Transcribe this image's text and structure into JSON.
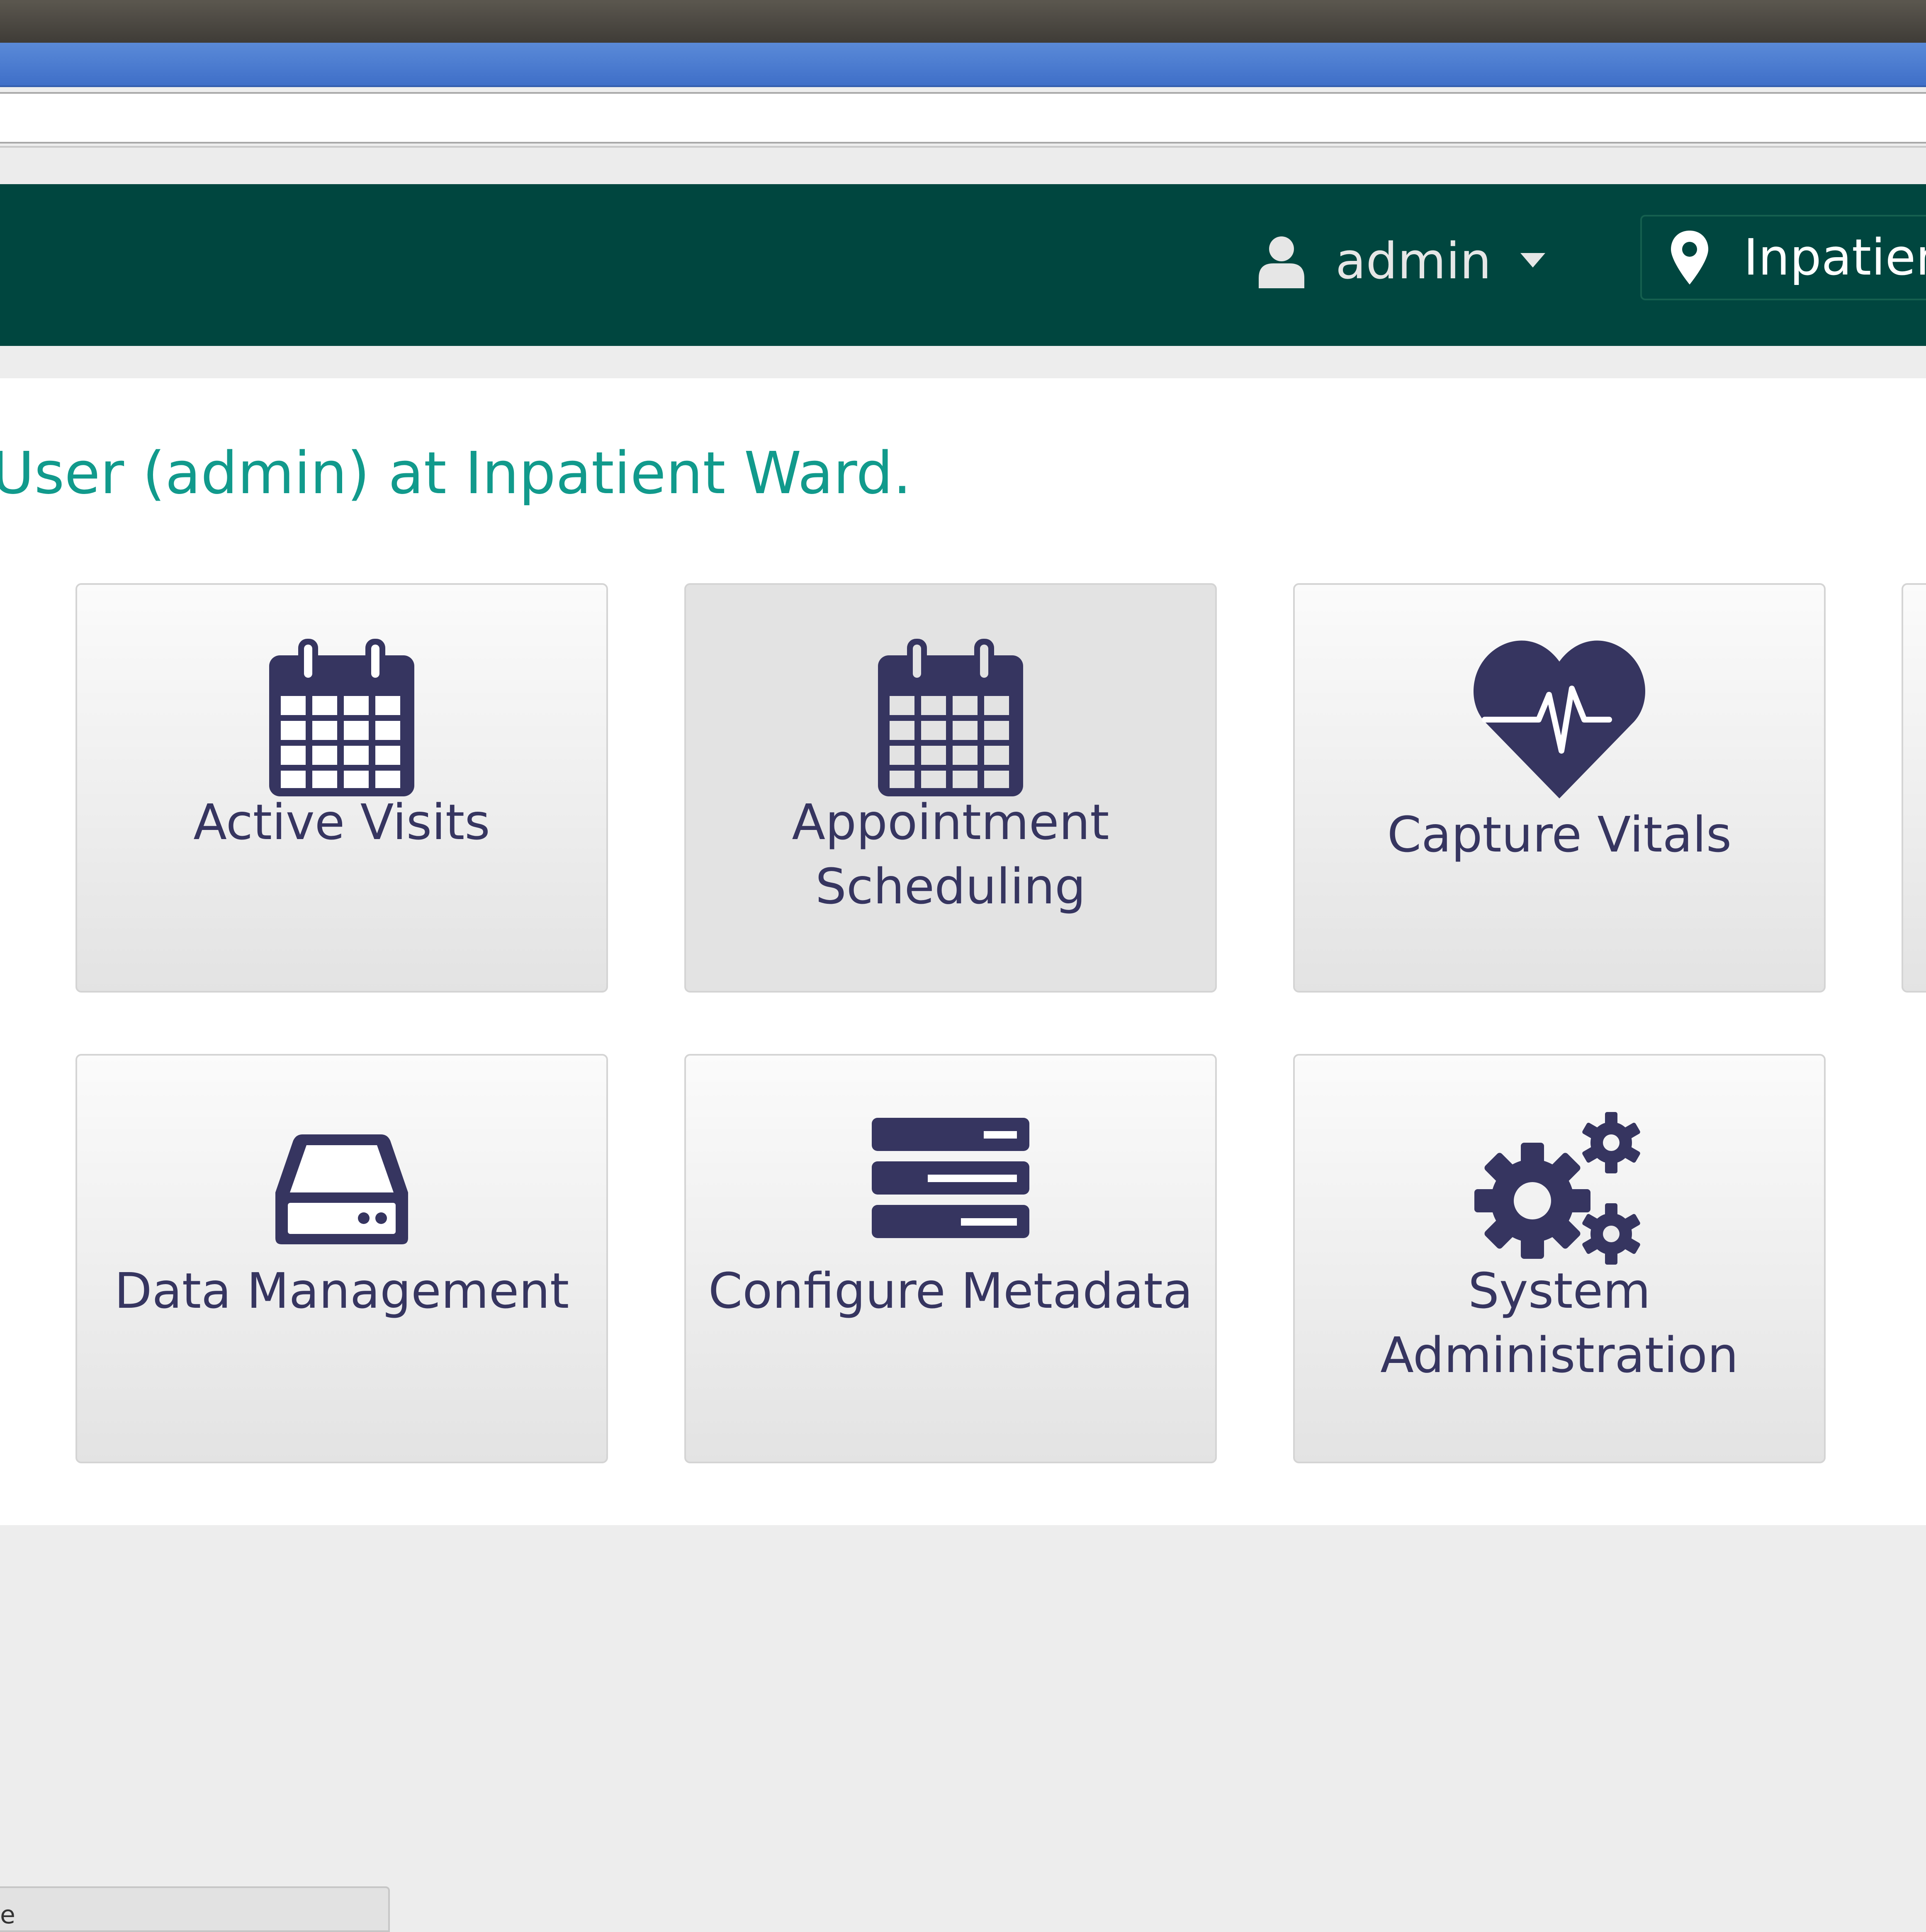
{
  "header": {
    "user_name": "admin",
    "location_name": "Inpatient Ward"
  },
  "welcome": {
    "text": "User (admin) at Inpatient Ward."
  },
  "apps": [
    {
      "label": "Active Visits",
      "icon": "calendar-icon"
    },
    {
      "label": "Appointment Scheduling",
      "icon": "calendar-icon"
    },
    {
      "label": "Capture Vitals",
      "icon": "heartbeat-icon"
    },
    {
      "label": "Data Management",
      "icon": "hard-drive-icon"
    },
    {
      "label": "Configure Metadata",
      "icon": "server-icon"
    },
    {
      "label": "System Administration",
      "icon": "gears-icon"
    }
  ],
  "status_bar": {
    "text": "e"
  },
  "colors": {
    "header_bg": "#00463f",
    "accent_teal": "#119a8c",
    "icon_navy": "#363560",
    "browser_blue": "#4a7bd0"
  }
}
